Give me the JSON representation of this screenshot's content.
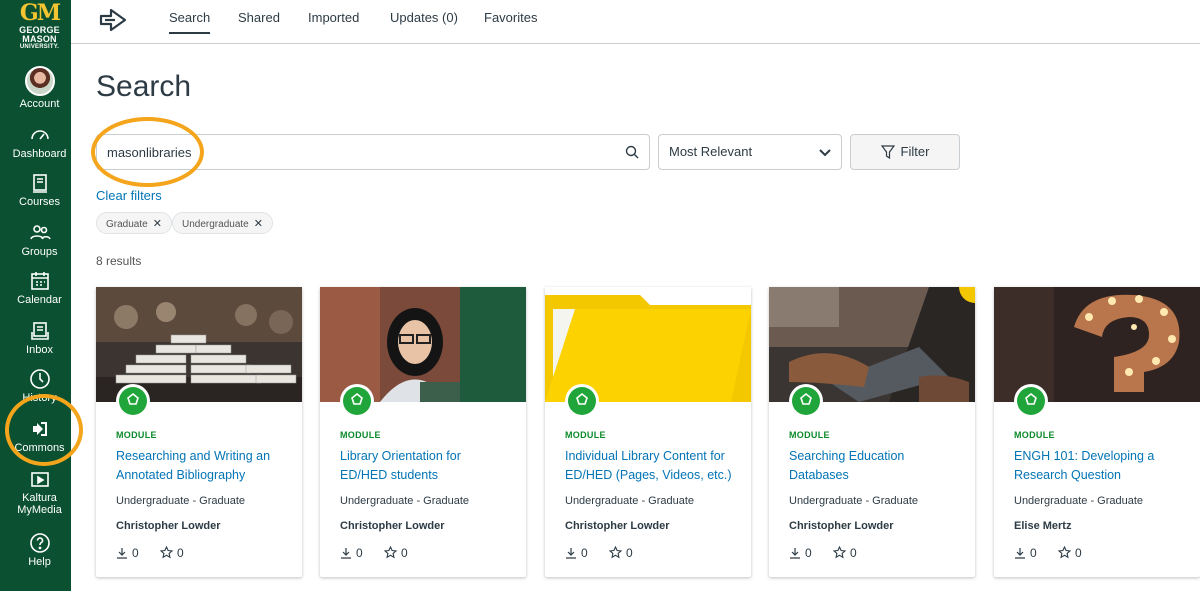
{
  "global_nav": {
    "logo": {
      "monogram": "GM",
      "line1": "GEORGE",
      "line2": "MASON",
      "line3": "UNIVERSITY."
    },
    "items": [
      {
        "label": "Account",
        "icon": "avatar"
      },
      {
        "label": "Dashboard",
        "icon": "dashboard-icon"
      },
      {
        "label": "Courses",
        "icon": "courses-icon"
      },
      {
        "label": "Groups",
        "icon": "groups-icon"
      },
      {
        "label": "Calendar",
        "icon": "calendar-icon"
      },
      {
        "label": "Inbox",
        "icon": "inbox-icon"
      },
      {
        "label": "History",
        "icon": "history-icon"
      },
      {
        "label": "Commons",
        "icon": "commons-icon"
      },
      {
        "label": "Kaltura MyMedia",
        "line1": "Kaltura",
        "line2": "MyMedia",
        "icon": "kaltura-icon"
      },
      {
        "label": "Help",
        "icon": "help-icon"
      }
    ],
    "highlight_color": "#f4a51c",
    "background_color": "#0b5131"
  },
  "top_tabs": [
    {
      "label": "Search",
      "active": true
    },
    {
      "label": "Shared"
    },
    {
      "label": "Imported"
    },
    {
      "label": "Updates (0)"
    },
    {
      "label": "Favorites"
    }
  ],
  "main": {
    "title": "Search",
    "search": {
      "value": "masonlibraries",
      "placeholder": ""
    },
    "sort": {
      "selected": "Most Relevant"
    },
    "filter_label": "Filter",
    "clear_filters": "Clear filters",
    "chips": [
      "Graduate",
      "Undergraduate"
    ],
    "results_count": "8 results"
  },
  "cards": [
    {
      "type": "MODULE",
      "title": "Researching and Writing an Annotated Bibliography",
      "levels": "Undergraduate - Graduate",
      "author": "Christopher Lowder",
      "downloads": "0",
      "favorites": "0",
      "thumb": "books"
    },
    {
      "type": "MODULE",
      "title": "Library Orientation for ED/HED students",
      "levels": "Undergraduate - Graduate",
      "author": "Christopher Lowder",
      "downloads": "0",
      "favorites": "0",
      "thumb": "student"
    },
    {
      "type": "MODULE",
      "title": "Individual Library Content for ED/HED (Pages, Videos, etc.)",
      "levels": "Undergraduate - Graduate",
      "author": "Christopher Lowder",
      "downloads": "0",
      "favorites": "0",
      "thumb": "folder"
    },
    {
      "type": "MODULE",
      "title": "Searching Education Databases",
      "levels": "Undergraduate - Graduate",
      "author": "Christopher Lowder",
      "downloads": "0",
      "favorites": "0",
      "thumb": "laptop"
    },
    {
      "type": "MODULE",
      "title": "ENGH 101: Developing a Research Question",
      "levels": "Undergraduate - Graduate",
      "author": "Elise Mertz",
      "downloads": "0",
      "favorites": "0",
      "thumb": "question-mark"
    }
  ],
  "colors": {
    "accent_green": "#20a53a",
    "link_blue": "#0374b5",
    "folder_yellow": "#fcd200"
  }
}
